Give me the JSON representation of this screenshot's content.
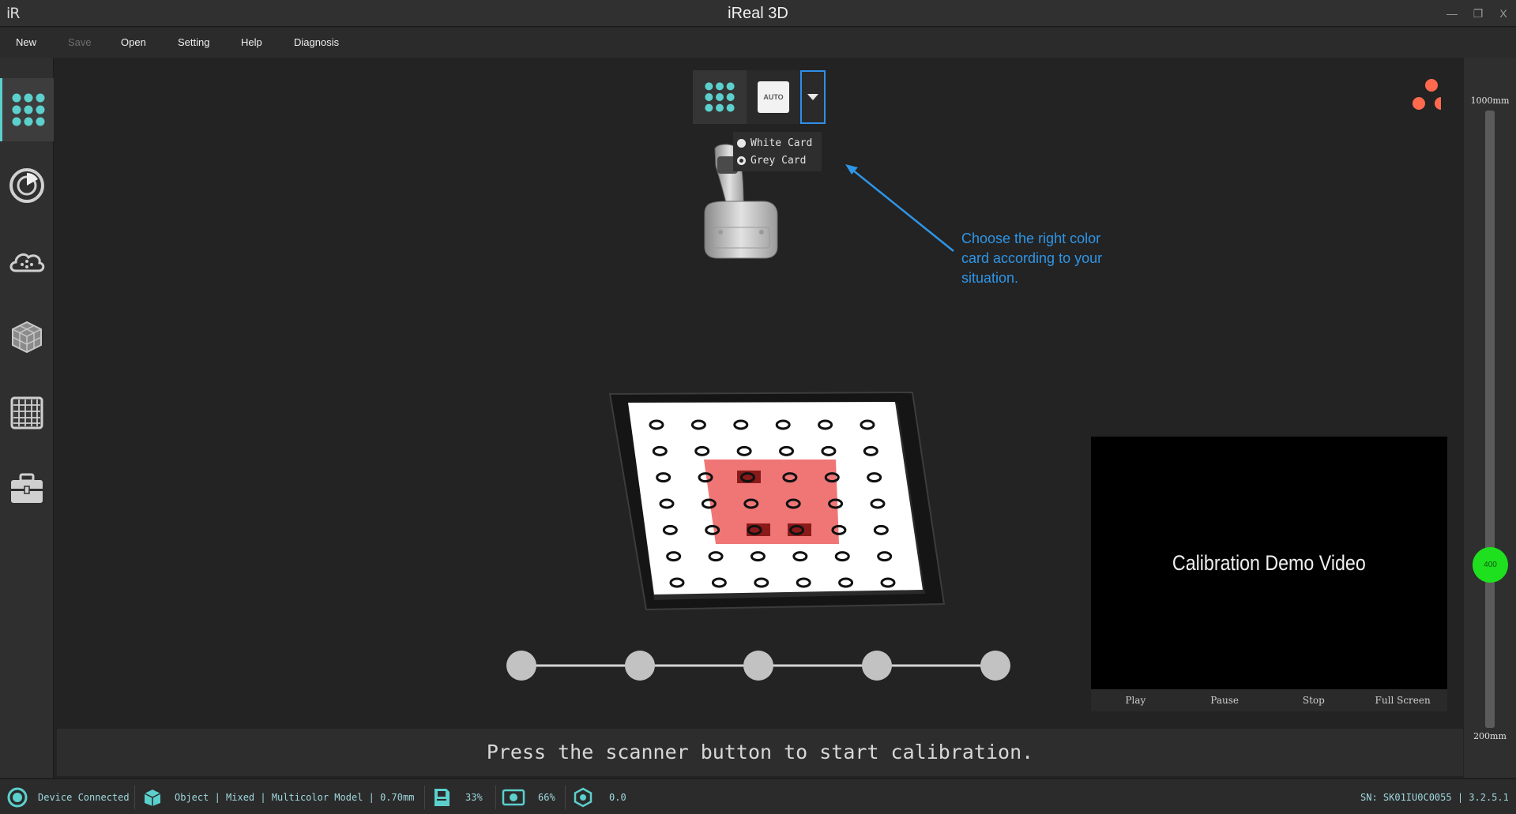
{
  "window": {
    "logo": "iR",
    "title": "iReal 3D",
    "minimize": "—",
    "restore": "❐",
    "close": "X"
  },
  "menu": {
    "new": "New",
    "save": "Save",
    "open": "Open",
    "setting": "Setting",
    "help": "Help",
    "diagnosis": "Diagnosis"
  },
  "toolbar": {
    "tools": [
      "calibration-grid-icon",
      "scan-target-icon",
      "point-cloud-icon",
      "mesh-cube-icon",
      "texture-grid-icon",
      "toolbox-icon"
    ],
    "active": "calibration-grid-icon"
  },
  "controls": {
    "auto_label": "AUTO"
  },
  "card_menu": {
    "white": "White Card",
    "grey": "Grey Card",
    "selected": "Grey Card"
  },
  "callout": {
    "text": "Choose the right color card according to your situation."
  },
  "video": {
    "title": "Calibration Demo Video",
    "play": "Play",
    "pause": "Pause",
    "stop": "Stop",
    "fullscreen": "Full Screen"
  },
  "hint": "Press the scanner button to start calibration.",
  "distance": {
    "max": "1000mm",
    "min": "200mm",
    "value": "400",
    "current_mm": 400
  },
  "progress": {
    "steps": 5,
    "completed": 0
  },
  "colors": {
    "accent": "#5cd0cd",
    "callout": "#2f95e6",
    "slider_knob": "#1fe01f",
    "logo_dots": "#ff6a4f",
    "highlight_region": "#f07676"
  },
  "status": {
    "device": "Device Connected",
    "mode": "Object | Mixed | Multicolor Model | 0.70mm",
    "storage": "33%",
    "memory": "66%",
    "value": "0.0",
    "serial": "SN: SK01IU0C0055 | 3.2.5.1"
  }
}
